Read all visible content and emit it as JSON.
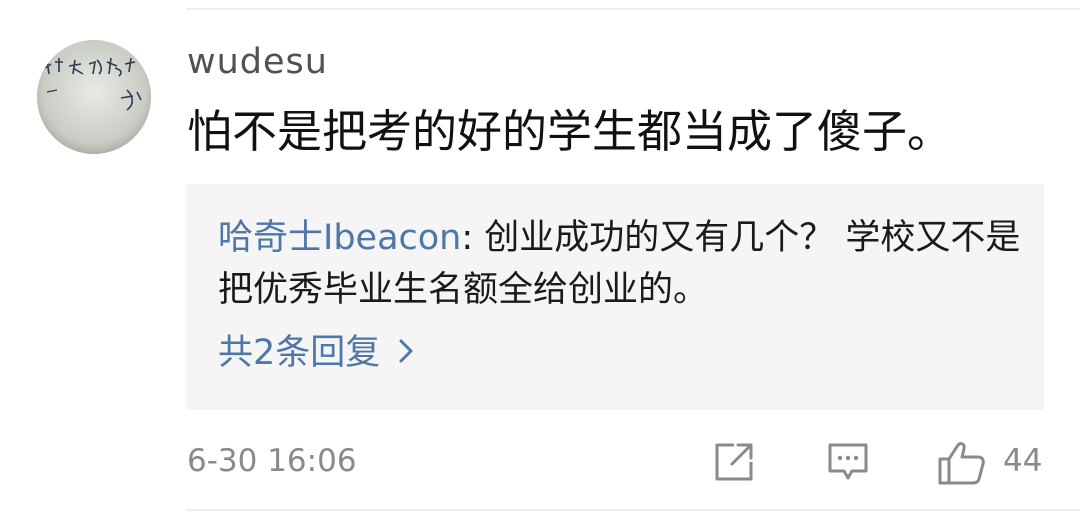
{
  "comment": {
    "username": "wudesu",
    "text": "怕不是把考的好的学生都当成了傻子。",
    "timestamp": "6-30 16:06",
    "like_count": "44"
  },
  "reply": {
    "author": "哈奇士Ibeacon",
    "separator": ": ",
    "text": "创业成功的又有几个？ 学校又不是把优秀毕业生名额全给创业的。",
    "more_label": "共2条回复"
  },
  "avatar": {
    "handwriting": "中大和开始 一切"
  },
  "icons": {
    "share": "share-icon",
    "reply": "comment-icon",
    "like": "thumbs-up-icon",
    "more": "chevron-right-icon"
  },
  "colors": {
    "link": "#4f76a7",
    "meta": "#8a8a8a",
    "reply_bg": "#f5f5f5"
  }
}
